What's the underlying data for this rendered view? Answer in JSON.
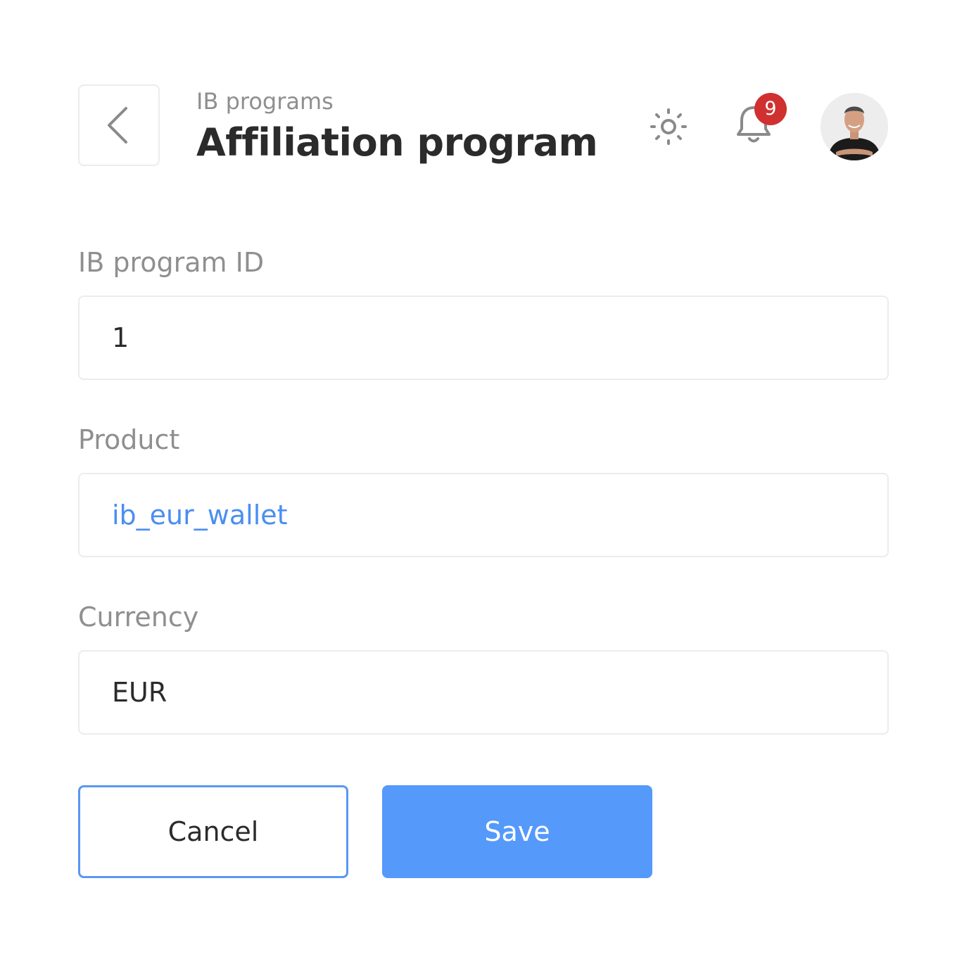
{
  "header": {
    "breadcrumb": "IB programs",
    "title": "Affiliation program",
    "back_icon": "chevron-left-icon",
    "theme_icon": "sun-icon",
    "notification_icon": "bell-icon",
    "notification_count": "9"
  },
  "form": {
    "fields": [
      {
        "label": "IB program ID",
        "value": "1"
      },
      {
        "label": "Product",
        "value": "ib_eur_wallet"
      },
      {
        "label": "Currency",
        "value": "EUR"
      }
    ]
  },
  "actions": {
    "cancel_label": "Cancel",
    "save_label": "Save"
  },
  "colors": {
    "accent": "#5599fb",
    "link": "#4a8ef2",
    "badge": "#d0302f",
    "muted_text": "#8f8f8f",
    "border": "#ececec"
  }
}
